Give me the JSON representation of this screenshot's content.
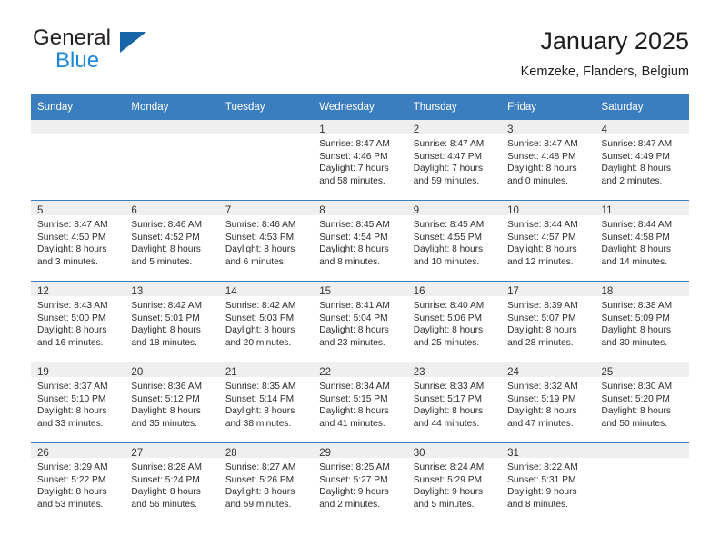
{
  "brand": {
    "name_part1": "General",
    "name_part2": "Blue",
    "logo_icon": "triangle-logo-icon"
  },
  "header": {
    "title": "January 2025",
    "location": "Kemzeke, Flanders, Belgium"
  },
  "calendar": {
    "weekday_headers": [
      "Sunday",
      "Monday",
      "Tuesday",
      "Wednesday",
      "Thursday",
      "Friday",
      "Saturday"
    ],
    "accent_color": "#3a7ebf",
    "daynum_band_color": "#efefef",
    "weeks": [
      [
        {
          "day": "",
          "lines": []
        },
        {
          "day": "",
          "lines": []
        },
        {
          "day": "",
          "lines": []
        },
        {
          "day": "1",
          "lines": [
            "Sunrise: 8:47 AM",
            "Sunset: 4:46 PM",
            "Daylight: 7 hours",
            "and 58 minutes."
          ]
        },
        {
          "day": "2",
          "lines": [
            "Sunrise: 8:47 AM",
            "Sunset: 4:47 PM",
            "Daylight: 7 hours",
            "and 59 minutes."
          ]
        },
        {
          "day": "3",
          "lines": [
            "Sunrise: 8:47 AM",
            "Sunset: 4:48 PM",
            "Daylight: 8 hours",
            "and 0 minutes."
          ]
        },
        {
          "day": "4",
          "lines": [
            "Sunrise: 8:47 AM",
            "Sunset: 4:49 PM",
            "Daylight: 8 hours",
            "and 2 minutes."
          ]
        }
      ],
      [
        {
          "day": "5",
          "lines": [
            "Sunrise: 8:47 AM",
            "Sunset: 4:50 PM",
            "Daylight: 8 hours",
            "and 3 minutes."
          ]
        },
        {
          "day": "6",
          "lines": [
            "Sunrise: 8:46 AM",
            "Sunset: 4:52 PM",
            "Daylight: 8 hours",
            "and 5 minutes."
          ]
        },
        {
          "day": "7",
          "lines": [
            "Sunrise: 8:46 AM",
            "Sunset: 4:53 PM",
            "Daylight: 8 hours",
            "and 6 minutes."
          ]
        },
        {
          "day": "8",
          "lines": [
            "Sunrise: 8:45 AM",
            "Sunset: 4:54 PM",
            "Daylight: 8 hours",
            "and 8 minutes."
          ]
        },
        {
          "day": "9",
          "lines": [
            "Sunrise: 8:45 AM",
            "Sunset: 4:55 PM",
            "Daylight: 8 hours",
            "and 10 minutes."
          ]
        },
        {
          "day": "10",
          "lines": [
            "Sunrise: 8:44 AM",
            "Sunset: 4:57 PM",
            "Daylight: 8 hours",
            "and 12 minutes."
          ]
        },
        {
          "day": "11",
          "lines": [
            "Sunrise: 8:44 AM",
            "Sunset: 4:58 PM",
            "Daylight: 8 hours",
            "and 14 minutes."
          ]
        }
      ],
      [
        {
          "day": "12",
          "lines": [
            "Sunrise: 8:43 AM",
            "Sunset: 5:00 PM",
            "Daylight: 8 hours",
            "and 16 minutes."
          ]
        },
        {
          "day": "13",
          "lines": [
            "Sunrise: 8:42 AM",
            "Sunset: 5:01 PM",
            "Daylight: 8 hours",
            "and 18 minutes."
          ]
        },
        {
          "day": "14",
          "lines": [
            "Sunrise: 8:42 AM",
            "Sunset: 5:03 PM",
            "Daylight: 8 hours",
            "and 20 minutes."
          ]
        },
        {
          "day": "15",
          "lines": [
            "Sunrise: 8:41 AM",
            "Sunset: 5:04 PM",
            "Daylight: 8 hours",
            "and 23 minutes."
          ]
        },
        {
          "day": "16",
          "lines": [
            "Sunrise: 8:40 AM",
            "Sunset: 5:06 PM",
            "Daylight: 8 hours",
            "and 25 minutes."
          ]
        },
        {
          "day": "17",
          "lines": [
            "Sunrise: 8:39 AM",
            "Sunset: 5:07 PM",
            "Daylight: 8 hours",
            "and 28 minutes."
          ]
        },
        {
          "day": "18",
          "lines": [
            "Sunrise: 8:38 AM",
            "Sunset: 5:09 PM",
            "Daylight: 8 hours",
            "and 30 minutes."
          ]
        }
      ],
      [
        {
          "day": "19",
          "lines": [
            "Sunrise: 8:37 AM",
            "Sunset: 5:10 PM",
            "Daylight: 8 hours",
            "and 33 minutes."
          ]
        },
        {
          "day": "20",
          "lines": [
            "Sunrise: 8:36 AM",
            "Sunset: 5:12 PM",
            "Daylight: 8 hours",
            "and 35 minutes."
          ]
        },
        {
          "day": "21",
          "lines": [
            "Sunrise: 8:35 AM",
            "Sunset: 5:14 PM",
            "Daylight: 8 hours",
            "and 38 minutes."
          ]
        },
        {
          "day": "22",
          "lines": [
            "Sunrise: 8:34 AM",
            "Sunset: 5:15 PM",
            "Daylight: 8 hours",
            "and 41 minutes."
          ]
        },
        {
          "day": "23",
          "lines": [
            "Sunrise: 8:33 AM",
            "Sunset: 5:17 PM",
            "Daylight: 8 hours",
            "and 44 minutes."
          ]
        },
        {
          "day": "24",
          "lines": [
            "Sunrise: 8:32 AM",
            "Sunset: 5:19 PM",
            "Daylight: 8 hours",
            "and 47 minutes."
          ]
        },
        {
          "day": "25",
          "lines": [
            "Sunrise: 8:30 AM",
            "Sunset: 5:20 PM",
            "Daylight: 8 hours",
            "and 50 minutes."
          ]
        }
      ],
      [
        {
          "day": "26",
          "lines": [
            "Sunrise: 8:29 AM",
            "Sunset: 5:22 PM",
            "Daylight: 8 hours",
            "and 53 minutes."
          ]
        },
        {
          "day": "27",
          "lines": [
            "Sunrise: 8:28 AM",
            "Sunset: 5:24 PM",
            "Daylight: 8 hours",
            "and 56 minutes."
          ]
        },
        {
          "day": "28",
          "lines": [
            "Sunrise: 8:27 AM",
            "Sunset: 5:26 PM",
            "Daylight: 8 hours",
            "and 59 minutes."
          ]
        },
        {
          "day": "29",
          "lines": [
            "Sunrise: 8:25 AM",
            "Sunset: 5:27 PM",
            "Daylight: 9 hours",
            "and 2 minutes."
          ]
        },
        {
          "day": "30",
          "lines": [
            "Sunrise: 8:24 AM",
            "Sunset: 5:29 PM",
            "Daylight: 9 hours",
            "and 5 minutes."
          ]
        },
        {
          "day": "31",
          "lines": [
            "Sunrise: 8:22 AM",
            "Sunset: 5:31 PM",
            "Daylight: 9 hours",
            "and 8 minutes."
          ]
        },
        {
          "day": "",
          "lines": []
        }
      ]
    ]
  }
}
